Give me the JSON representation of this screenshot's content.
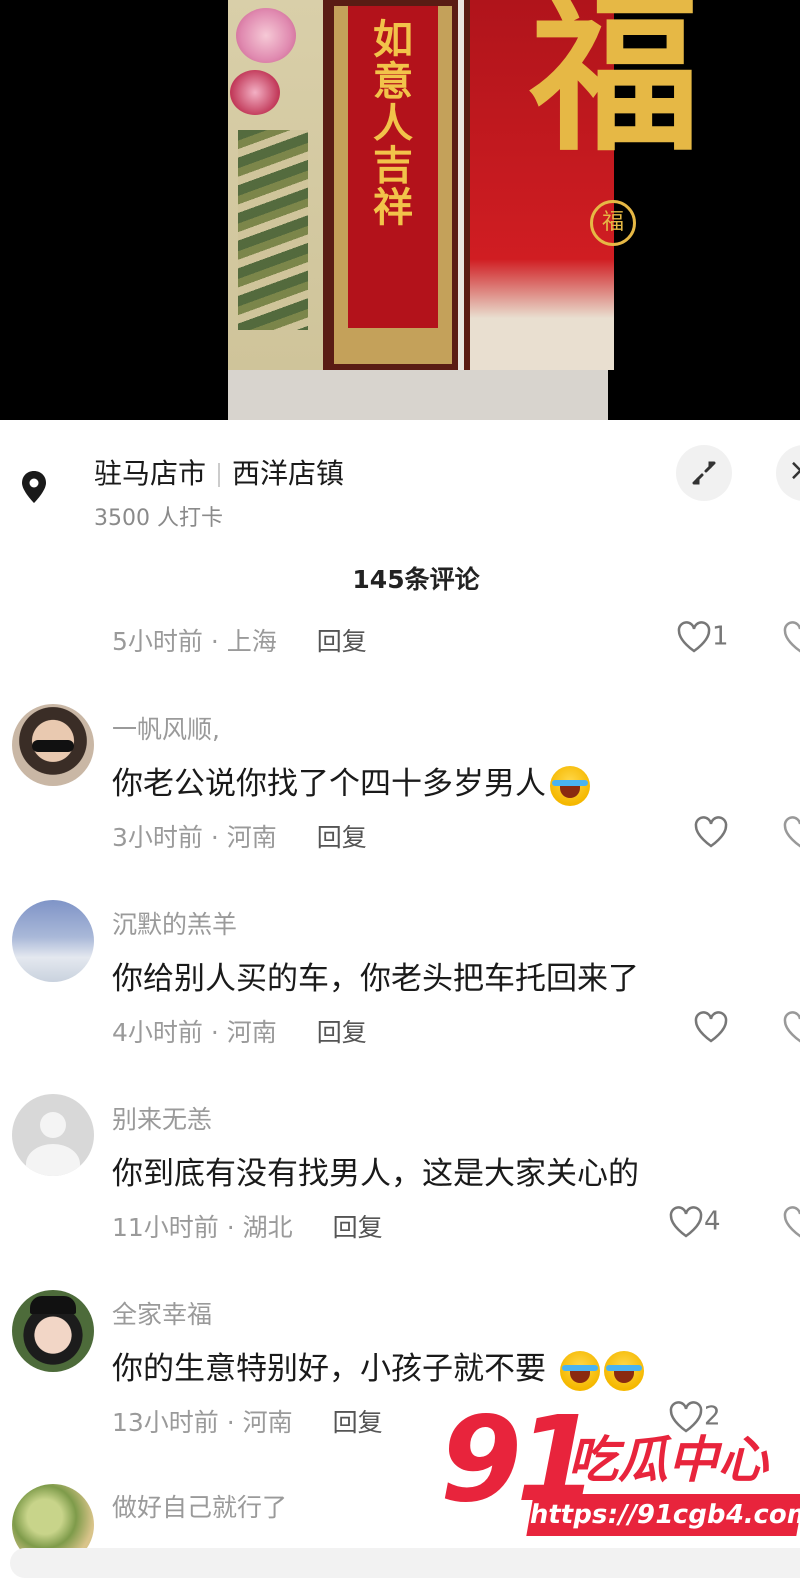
{
  "video": {
    "couplet_text": "如意人吉祥",
    "fu_char": "福",
    "seal_char": "福"
  },
  "location": {
    "city": "驻马店市",
    "town": "西洋店镇",
    "checkins": "3500 人打卡"
  },
  "close_glyph": "×",
  "comment_count": "145条评论",
  "reply_label": "回复",
  "top_comment_tail": {
    "time_loc": "5小时前 · 上海",
    "likes": "1"
  },
  "comments": [
    {
      "name": "一帆风顺,",
      "text": "你老公说你找了个四十多岁男人",
      "emoji_count": 1,
      "time_loc": "3小时前 · 河南",
      "likes": ""
    },
    {
      "name": "沉默的羔羊",
      "text": "你给别人买的车，你老头把车托回来了",
      "emoji_count": 0,
      "time_loc": "4小时前 · 河南",
      "likes": ""
    },
    {
      "name": "别来无恙",
      "text": "你到底有没有找男人，这是大家关心的",
      "emoji_count": 0,
      "time_loc": "11小时前 · 湖北",
      "likes": "4"
    },
    {
      "name": "全家幸福",
      "text": "你的生意特别好，小孩子就不要",
      "emoji_count": 2,
      "time_loc": "13小时前 · 河南",
      "likes": "2"
    },
    {
      "name": "做好自己就行了",
      "text": "",
      "emoji_count": 0,
      "time_loc": "",
      "likes": ""
    }
  ],
  "watermark": {
    "number": "91",
    "name": "吃瓜中心",
    "url": "https://91cgb4.com"
  },
  "colors": {
    "brand_red": "#e8243c",
    "meta_gray": "#9a9a9a"
  }
}
